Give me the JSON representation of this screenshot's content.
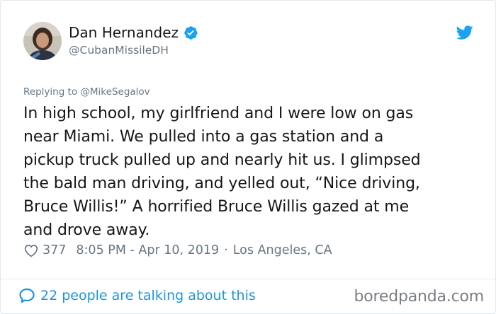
{
  "tweet": {
    "display_name": "Dan Hernandez",
    "handle": "@CubanMissileDH",
    "replying_prefix": "Replying to",
    "replying_to": "@MikeSegalov",
    "text": "In high school, my girlfriend and I were low on gas\nnear Miami. We pulled into a gas station and a\npickup truck pulled up and nearly hit us. I glimpsed\nthe bald man driving, and yelled out, “Nice driving,\nBruce Willis!” A horrified Bruce Willis gazed at me\nand drove away.",
    "likes": "377",
    "time": "8:05 PM - Apr 10, 2019",
    "separator": "·",
    "location": "Los Angeles, CA",
    "talking": "22 people are talking about this"
  },
  "icons": {
    "verified": "verified-badge-icon",
    "bird": "twitter-bird-icon",
    "heart": "heart-icon",
    "bubble": "comment-bubble-icon"
  },
  "colors": {
    "accent": "#1b95e0",
    "secondary_text": "#657786",
    "primary_text": "#14171a"
  },
  "watermark": "boredpanda.com"
}
